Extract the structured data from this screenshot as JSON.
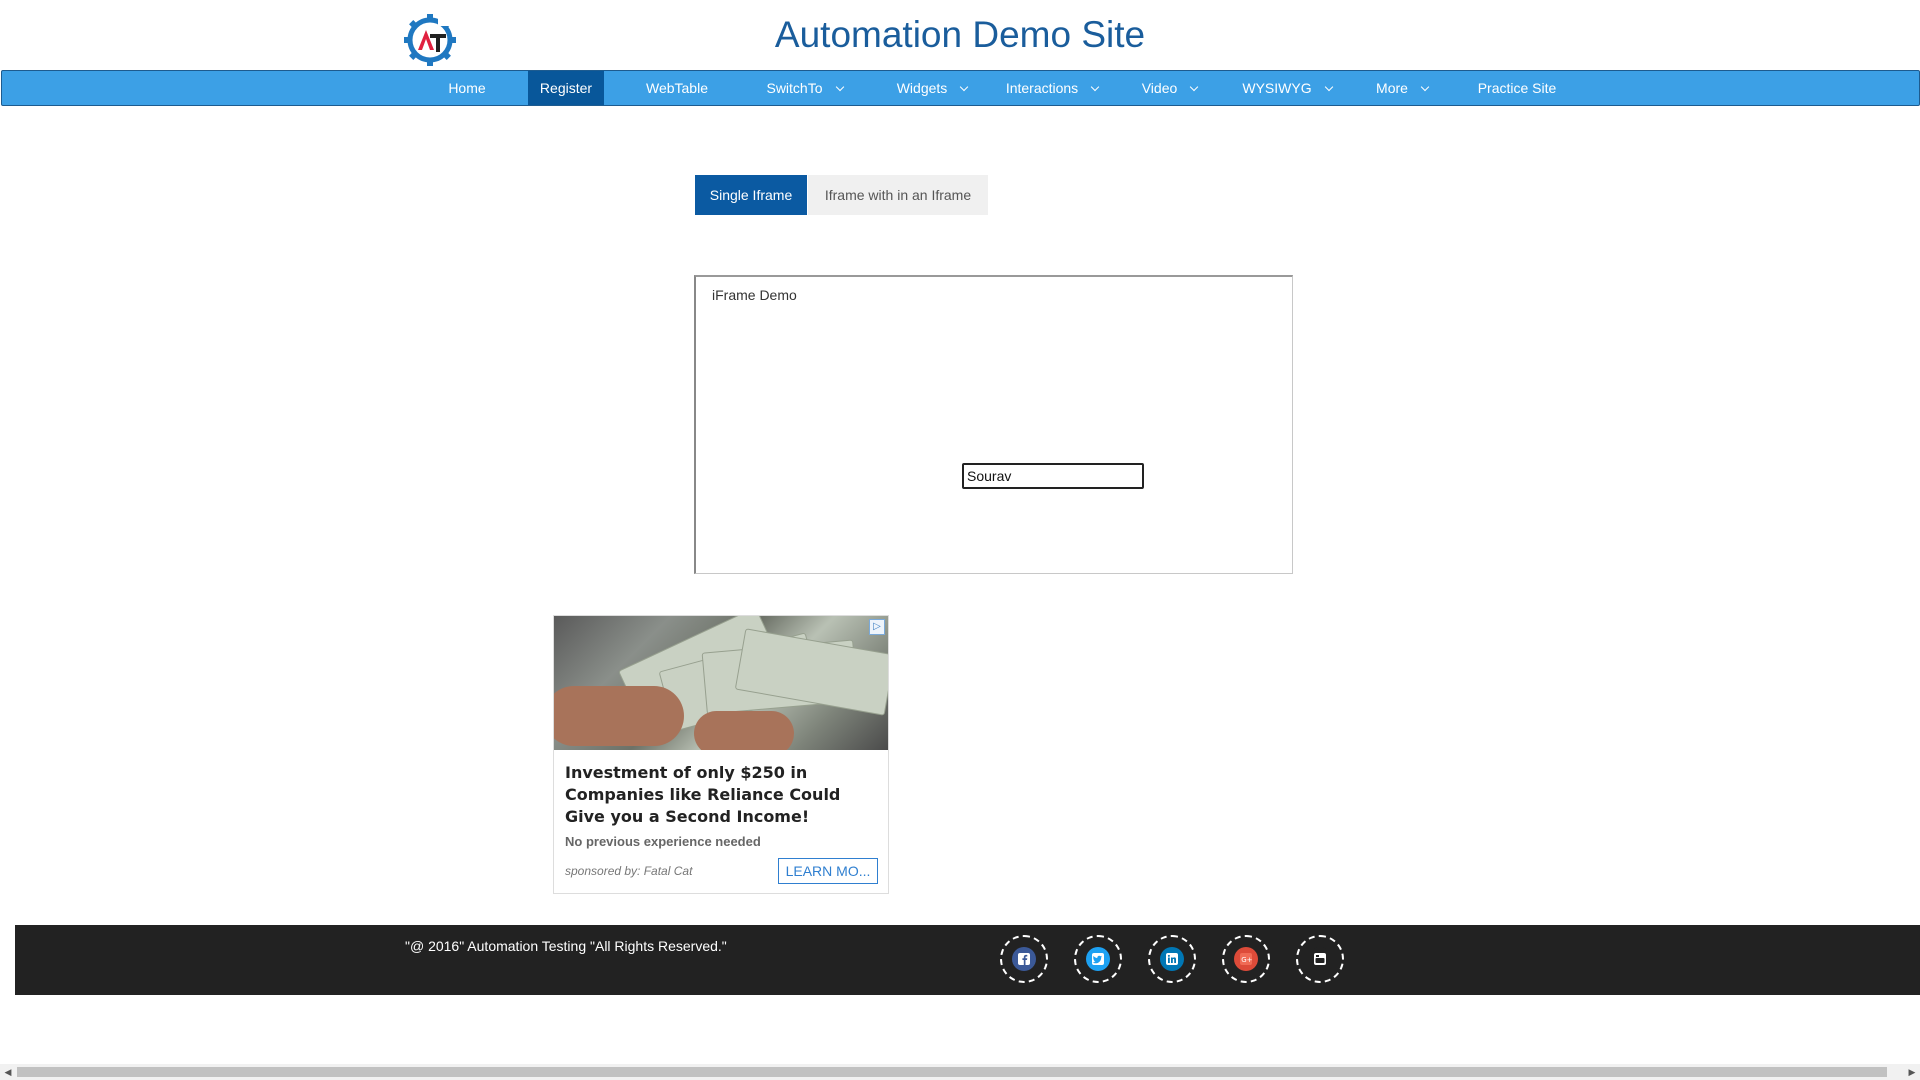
{
  "header": {
    "title": "Automation Demo Site",
    "logo_icon": "gear-logo-icon"
  },
  "nav": {
    "items": [
      {
        "label": "Home"
      },
      {
        "label": "Register"
      },
      {
        "label": "WebTable"
      },
      {
        "label": "SwitchTo"
      },
      {
        "label": "Widgets"
      },
      {
        "label": "Interactions"
      },
      {
        "label": "Video"
      },
      {
        "label": "WYSIWYG"
      },
      {
        "label": "More"
      },
      {
        "label": "Practice Site"
      }
    ],
    "active": "Register"
  },
  "tabs": {
    "single": "Single Iframe",
    "nested": "Iframe with in an Iframe"
  },
  "iframe": {
    "title": "iFrame Demo",
    "input_value": "Sourav"
  },
  "ad": {
    "headline": "Investment of only $250 in Companies like Reliance Could Give you a Second Income!",
    "subtext": "No previous experience needed",
    "sponsor": "sponsored by: Fatal Cat",
    "cta": "LEARN MO..."
  },
  "footer": {
    "copyright": "\"@ 2016\" Automation Testing \"All Rights Reserved.\"",
    "social": [
      {
        "icon": "facebook-icon",
        "color": "#3b5998"
      },
      {
        "icon": "twitter-icon",
        "color": "#1da1f2"
      },
      {
        "icon": "linkedin-icon",
        "color": "#0077b5"
      },
      {
        "icon": "google-plus-icon",
        "color": "#dd4b39"
      },
      {
        "icon": "youtube-icon",
        "color": "#ffffff"
      }
    ]
  },
  "colors": {
    "brand_title": "#1a5d9c",
    "navbar": "#3ca0e6",
    "nav_active": "#08579a",
    "tab_active": "#0b5aa2",
    "footer": "#222222"
  }
}
